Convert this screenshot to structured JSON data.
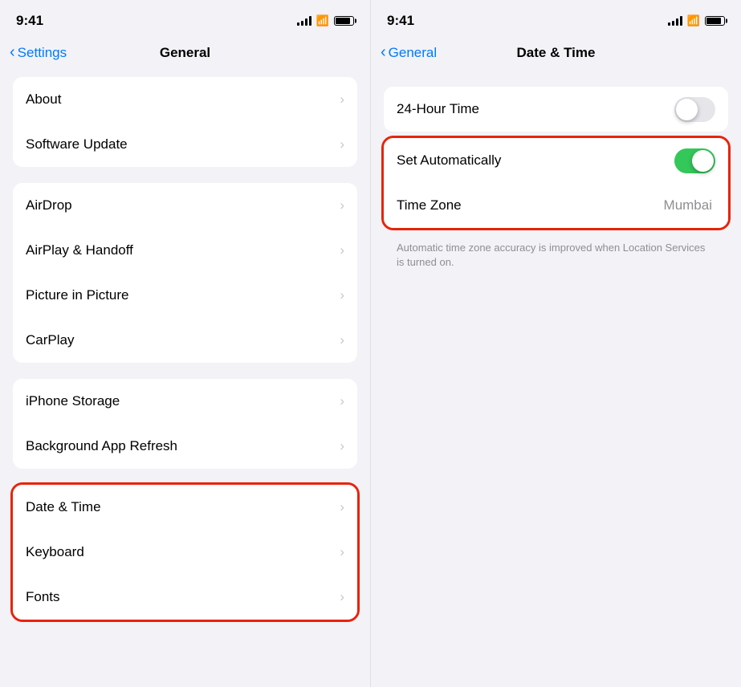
{
  "left": {
    "status": {
      "time": "9:41"
    },
    "nav": {
      "back_label": "Settings",
      "title": "General"
    },
    "groups": [
      {
        "id": "group1",
        "rows": [
          {
            "label": "About",
            "chevron": "›"
          },
          {
            "label": "Software Update",
            "chevron": "›"
          }
        ]
      },
      {
        "id": "group2",
        "rows": [
          {
            "label": "AirDrop",
            "chevron": "›"
          },
          {
            "label": "AirPlay & Handoff",
            "chevron": "›"
          },
          {
            "label": "Picture in Picture",
            "chevron": "›"
          },
          {
            "label": "CarPlay",
            "chevron": "›"
          }
        ]
      },
      {
        "id": "group3",
        "rows": [
          {
            "label": "iPhone Storage",
            "chevron": "›"
          },
          {
            "label": "Background App Refresh",
            "chevron": "›"
          }
        ]
      },
      {
        "id": "group4",
        "rows": [
          {
            "label": "Date & Time",
            "chevron": "›",
            "highlighted": true
          },
          {
            "label": "Keyboard",
            "chevron": "›"
          },
          {
            "label": "Fonts",
            "chevron": "›"
          }
        ]
      }
    ]
  },
  "right": {
    "status": {
      "time": "9:41"
    },
    "nav": {
      "back_label": "General",
      "title": "Date & Time"
    },
    "groups": [
      {
        "id": "rgroup1",
        "rows": [
          {
            "label": "24-Hour Time",
            "type": "toggle",
            "toggle_state": "off"
          }
        ]
      },
      {
        "id": "rgroup2",
        "rows": [
          {
            "label": "Set Automatically",
            "type": "toggle",
            "toggle_state": "on",
            "highlighted": true
          },
          {
            "label": "Time Zone",
            "type": "value",
            "value": "Mumbai"
          }
        ]
      }
    ],
    "footnote": "Automatic time zone accuracy is improved when Location Services is turned on."
  }
}
